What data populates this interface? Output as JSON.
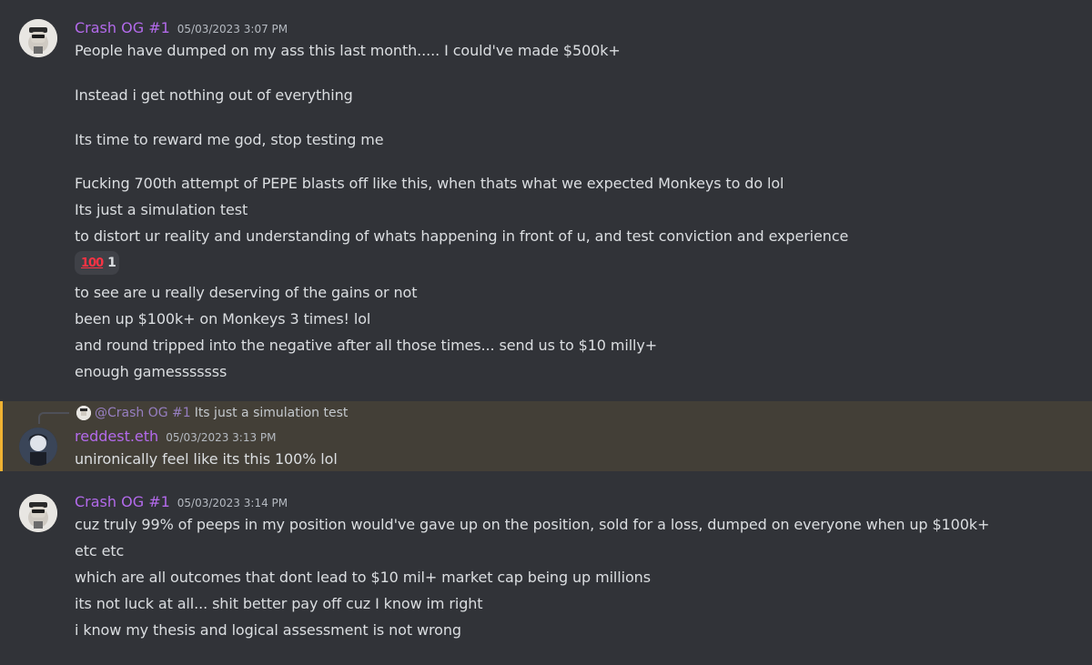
{
  "colors": {
    "background": "#313338",
    "username_purple": "#b36aeb",
    "highlight_bg": "#433f37",
    "highlight_bar": "#f0b232"
  },
  "messages": [
    {
      "author": "Crash OG #1",
      "timestamp": "05/03/2023 3:07 PM",
      "lines": [
        "People have dumped on my ass this last month..... I could've made $500k+",
        "Instead i get nothing out of everything",
        "Its time to reward me god, stop testing me",
        "Fucking 700th attempt of PEPE blasts off like this, when thats what we expected Monkeys to do lol",
        "Its just a simulation test",
        "to distort ur reality and understanding of whats happening in front of u, and test conviction and experience",
        "to see are u really deserving of the gains or not",
        "been up $100k+ on Monkeys 3 times! lol",
        "and round tripped into the negative after all those times... send us to $10 milly+",
        "enough gamesssssss"
      ],
      "reaction": {
        "emoji": "100",
        "emoji_icon": "hundred-points-icon",
        "count": "1"
      }
    },
    {
      "reply_to": {
        "mention": "@Crash OG #1",
        "text": "Its just a simulation test"
      },
      "author": "reddest.eth",
      "timestamp": "05/03/2023 3:13 PM",
      "lines": [
        "unironically feel like its this 100% lol"
      ]
    },
    {
      "author": "Crash OG #1",
      "timestamp": "05/03/2023 3:14 PM",
      "lines": [
        "cuz truly 99% of peeps in my position would've gave up on the position, sold for a loss, dumped on everyone when up $100k+",
        "etc etc",
        "which are all outcomes that dont lead to $10 mil+ market cap being up millions",
        "its not luck at all... shit better pay off cuz I know im right",
        "i know my thesis and logical assessment is not wrong"
      ]
    }
  ]
}
